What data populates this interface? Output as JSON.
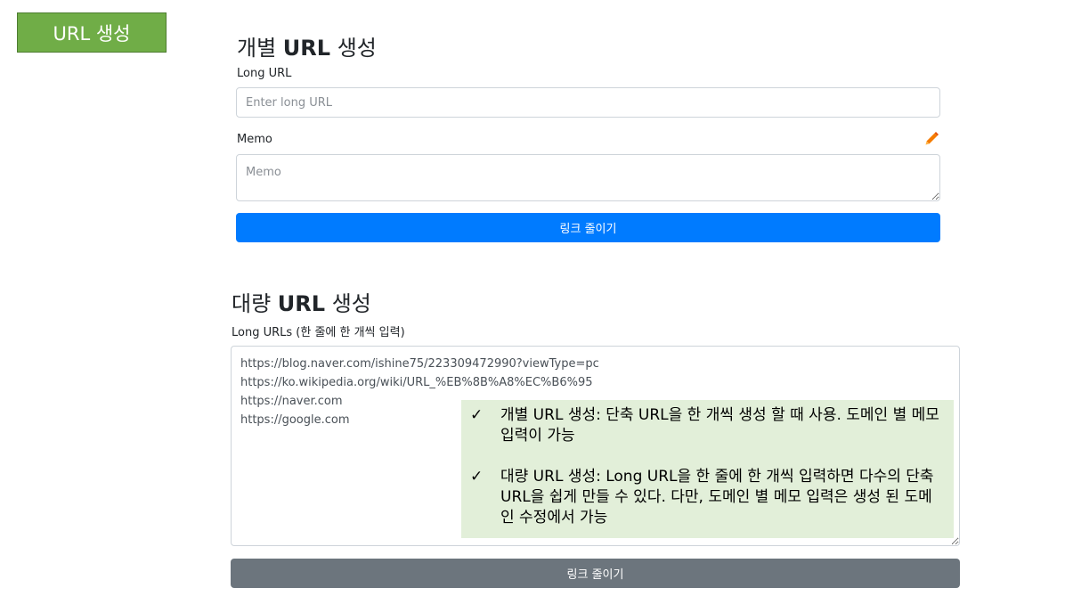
{
  "tag_label": "URL 생성",
  "single": {
    "title_prefix": "개별 ",
    "title_bold": "URL",
    "title_suffix": " 생성",
    "long_url_label": "Long URL",
    "long_url_placeholder": "Enter long URL",
    "memo_label": "Memo",
    "memo_placeholder": "Memo",
    "memo_icon": "pencil-icon",
    "submit_label": "링크 줄이기"
  },
  "bulk": {
    "title_prefix": "대량 ",
    "title_bold": "URL",
    "title_suffix": " 생성",
    "long_urls_label": "Long URLs (한 줄에 한 개씩 입력)",
    "long_urls_value": "https://blog.naver.com/ishine75/223309472990?viewType=pc\nhttps://ko.wikipedia.org/wiki/URL_%EB%8B%A8%EC%B6%95\nhttps://naver.com\nhttps://google.com",
    "submit_label": "링크 줄이기"
  },
  "notes": [
    {
      "check": "✓",
      "text": "개별 URL 생성: 단축 URL을 한 개씩 생성 할 때 사용. 도메인 별 메모 입력이 가능"
    },
    {
      "check": "✓",
      "text": "대량 URL 생성: Long URL을 한 줄에 한 개씩 입력하면 다수의 단축 URL을 쉽게 만들 수 있다. 다만, 도메인 별 메모 입력은 생성 된 도메인 수정에서 가능"
    }
  ],
  "colors": {
    "tag_green": "#70ad47",
    "primary_blue": "#007bff",
    "secondary_gray": "#6c757d",
    "note_bg": "#e2efd9",
    "pencil_orange": "#f57c00"
  }
}
